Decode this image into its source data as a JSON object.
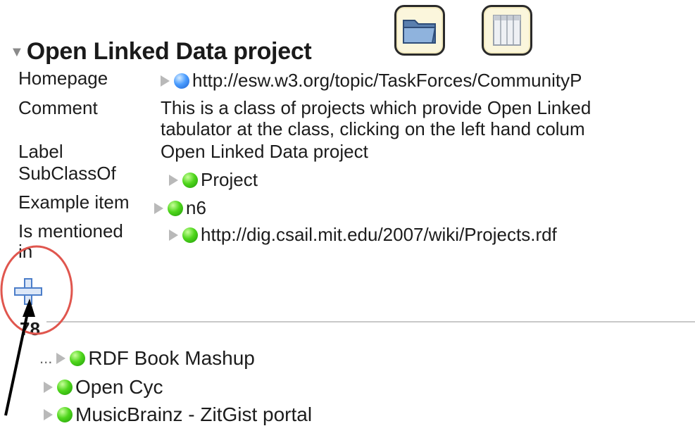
{
  "header": {
    "title": "Open Linked Data project"
  },
  "toolbar": {
    "folder_icon": "folder-icon",
    "table_icon": "table-view-icon"
  },
  "properties": [
    {
      "label": "Homepage",
      "value": "http://esw.w3.org/topic/TaskForces/CommunityP",
      "dot": "blue"
    },
    {
      "label": "Comment",
      "value_line1": "This is a class of projects which provide Open Linked",
      "value_line2": "tabulator at the class, clicking on the left hand colum"
    },
    {
      "label": "Label",
      "value": "Open Linked Data project"
    },
    {
      "label": "SubClassOf",
      "value": "Project",
      "dot": "green"
    },
    {
      "label": "Example item",
      "value": "n6",
      "dot": "green"
    },
    {
      "label_line1": "Is mentioned",
      "label_line2": "in",
      "value": "http://dig.csail.mit.edu/2007/wiki/Projects.rdf",
      "dot": "green"
    }
  ],
  "list": {
    "count": "78",
    "ellipsis": "...",
    "items": [
      "RDF Book Mashup",
      "Open Cyc",
      "MusicBrainz - ZitGist portal"
    ]
  },
  "colors": {
    "annotation_circle": "#e0564e",
    "arrow": "#000000",
    "green_dot": "#3fc41a",
    "blue_dot": "#3a8cf5",
    "plus_icon": "#5b86c8"
  }
}
